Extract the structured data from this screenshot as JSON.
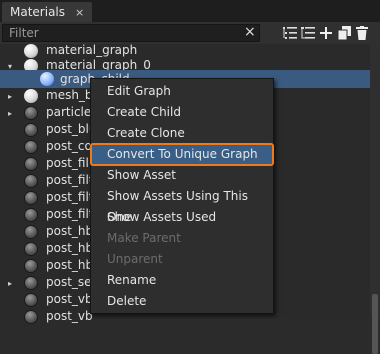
{
  "tab": {
    "title": "Materials",
    "close": "×"
  },
  "filter": {
    "placeholder": "Filter",
    "value": "Filter",
    "clear": "×"
  },
  "toolbar": {
    "icons": [
      "expand-all-icon",
      "collapse-all-icon",
      "add-icon",
      "clone-icon",
      "delete-icon"
    ]
  },
  "tree": {
    "items": [
      {
        "label": "material_graph",
        "ball": "white",
        "arrow": ""
      },
      {
        "label": "material_graph_0",
        "ball": "white",
        "arrow": "▾"
      },
      {
        "label": "graph_child",
        "ball": "blue",
        "arrow": ""
      },
      {
        "label": "mesh_b",
        "ball": "white",
        "arrow": "▸"
      },
      {
        "label": "particle",
        "ball": "gray",
        "arrow": "▸"
      },
      {
        "label": "post_blu",
        "ball": "gray",
        "arrow": ""
      },
      {
        "label": "post_co",
        "ball": "gray",
        "arrow": ""
      },
      {
        "label": "post_fil",
        "ball": "gray",
        "arrow": ""
      },
      {
        "label": "post_filt",
        "ball": "gray",
        "arrow": ""
      },
      {
        "label": "post_filt",
        "ball": "gray",
        "arrow": ""
      },
      {
        "label": "post_filt",
        "ball": "gray",
        "arrow": ""
      },
      {
        "label": "post_hb",
        "ball": "gray",
        "arrow": ""
      },
      {
        "label": "post_hb",
        "ball": "gray",
        "arrow": ""
      },
      {
        "label": "post_hb",
        "ball": "gray",
        "arrow": ""
      },
      {
        "label": "post_se",
        "ball": "gray",
        "arrow": "▸"
      },
      {
        "label": "post_vb",
        "ball": "gray",
        "arrow": ""
      },
      {
        "label": "post_vb",
        "ball": "gray",
        "arrow": ""
      }
    ]
  },
  "menu": {
    "items": [
      {
        "label": "Edit Graph",
        "disabled": false
      },
      {
        "label": "Create Child",
        "disabled": false
      },
      {
        "label": "Create Clone",
        "disabled": false
      },
      {
        "label": "Convert To Unique Graph",
        "disabled": false,
        "highlighted": true
      },
      {
        "label": "Show Asset",
        "disabled": false
      },
      {
        "label": "Show Assets Using This One",
        "disabled": false
      },
      {
        "label": "Show Assets Used",
        "disabled": false
      },
      {
        "label": "Make Parent",
        "disabled": true
      },
      {
        "label": "Unparent",
        "disabled": true
      },
      {
        "label": "Rename",
        "disabled": false
      },
      {
        "label": "Delete",
        "disabled": false
      }
    ]
  },
  "colors": {
    "highlight_outline": "#f07a1a",
    "selection": "#3a5a80",
    "menu_bg": "#2e2e2e"
  }
}
